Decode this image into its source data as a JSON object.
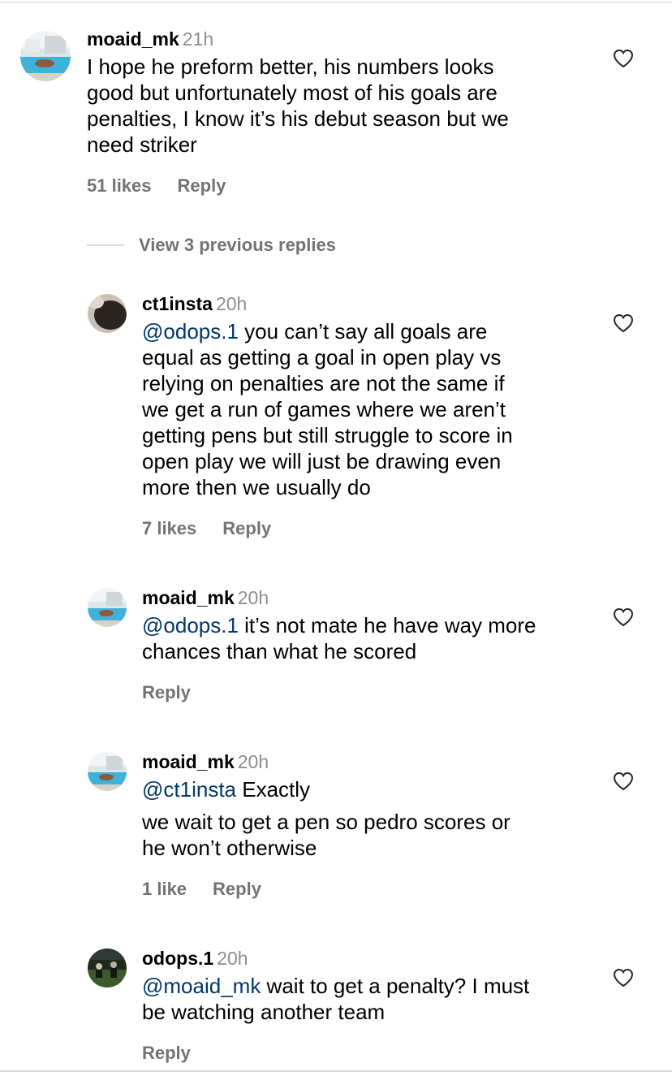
{
  "comments": [
    {
      "username": "moaid_mk",
      "time": "21h",
      "lines": [
        {
          "mention": "",
          "text": "I hope he preform better, his numbers looks"
        },
        {
          "mention": "",
          "text": "good but unfortunately most of his goals are"
        },
        {
          "mention": "",
          "text": "penalties, I know it’s his debut season but we"
        },
        {
          "mention": "",
          "text": "need striker"
        }
      ],
      "likes": "51 likes",
      "reply_label": "Reply"
    },
    {
      "username": "ct1insta",
      "time": "20h",
      "lines": [
        {
          "mention": "@odops.1",
          "text": " you can’t say all goals are"
        },
        {
          "mention": "",
          "text": "equal as getting a goal in open play vs"
        },
        {
          "mention": "",
          "text": "relying on penalties are not the same if"
        },
        {
          "mention": "",
          "text": "we get a run of games where we aren’t"
        },
        {
          "mention": "",
          "text": "getting pens but still struggle to score in"
        },
        {
          "mention": "",
          "text": "open play we will just be drawing even"
        },
        {
          "mention": "",
          "text": "more then we usually do"
        }
      ],
      "likes": "7 likes",
      "reply_label": "Reply"
    },
    {
      "username": "moaid_mk",
      "time": "20h",
      "lines": [
        {
          "mention": "@odops.1",
          "text": " it’s not mate he have way more"
        },
        {
          "mention": "",
          "text": "chances than what he scored"
        }
      ],
      "likes": "",
      "reply_label": "Reply"
    },
    {
      "username": "moaid_mk",
      "time": "20h",
      "lines": [
        {
          "mention": "@ct1insta",
          "text": " Exactly"
        },
        {
          "mention": "",
          "text": "we wait to get a pen so pedro scores or"
        },
        {
          "mention": "",
          "text": "he won’t otherwise"
        }
      ],
      "likes": "1 like",
      "reply_label": "Reply"
    },
    {
      "username": "odops.1",
      "time": "20h",
      "lines": [
        {
          "mention": "@moaid_mk",
          "text": " wait to get a penalty? I must"
        },
        {
          "mention": "",
          "text": "be watching another team"
        }
      ],
      "likes": "",
      "reply_label": "Reply"
    }
  ],
  "view_replies": {
    "label": "View 3 previous replies"
  },
  "colors": {
    "mention": "#00376b",
    "secondary_text": "#737373",
    "timestamp": "#8e8e8e"
  },
  "icons": {
    "like": "heart-outline-icon",
    "avatar": "user-avatar"
  }
}
